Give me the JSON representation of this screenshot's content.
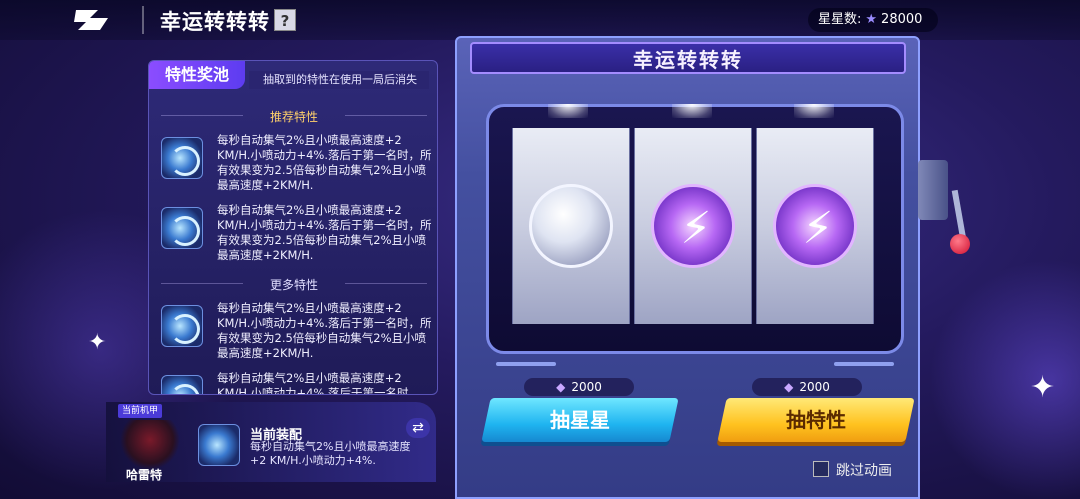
{
  "header": {
    "title": "幸运转转转",
    "help_label": "?",
    "stars_label": "星星数:",
    "stars_value": "28000"
  },
  "panel": {
    "tag": "特性奖池",
    "note": "抽取到的特性在使用一局后消失",
    "recommended_title": "推荐特性",
    "more_title": "更多特性",
    "items": [
      {
        "desc": "每秒自动集气2%且小喷最高速度+2 KM/H.小喷动力+4%.落后于第一名时，所有效果变为2.5倍每秒自动集气2%且小喷最高速度+2KM/H."
      },
      {
        "desc": "每秒自动集气2%且小喷最高速度+2 KM/H.小喷动力+4%.落后于第一名时，所有效果变为2.5倍每秒自动集气2%且小喷最高速度+2KM/H."
      },
      {
        "desc": "每秒自动集气2%且小喷最高速度+2 KM/H.小喷动力+4%.落后于第一名时，所有效果变为2.5倍每秒自动集气2%且小喷最高速度+2KM/H."
      },
      {
        "desc": "每秒自动集气2%且小喷最高速度+2 KM/H.小喷动力+4%.落后于第一名时"
      }
    ]
  },
  "mech": {
    "badge": "当前机甲",
    "name": "哈雷特",
    "equip_title": "当前装配",
    "equip_desc": "每秒自动集气2%且小喷最高速度+2 KM/H.小喷动力+4%.",
    "swap_icon": "⇄"
  },
  "machine": {
    "title": "幸运转转转",
    "reels": [
      "white-orb",
      "purple-bolt-orb",
      "purple-bolt-orb"
    ],
    "cost_left": "2000",
    "cost_right": "2000",
    "btn_left": "抽星星",
    "btn_right": "抽特性",
    "skip_label": "跳过动画"
  }
}
